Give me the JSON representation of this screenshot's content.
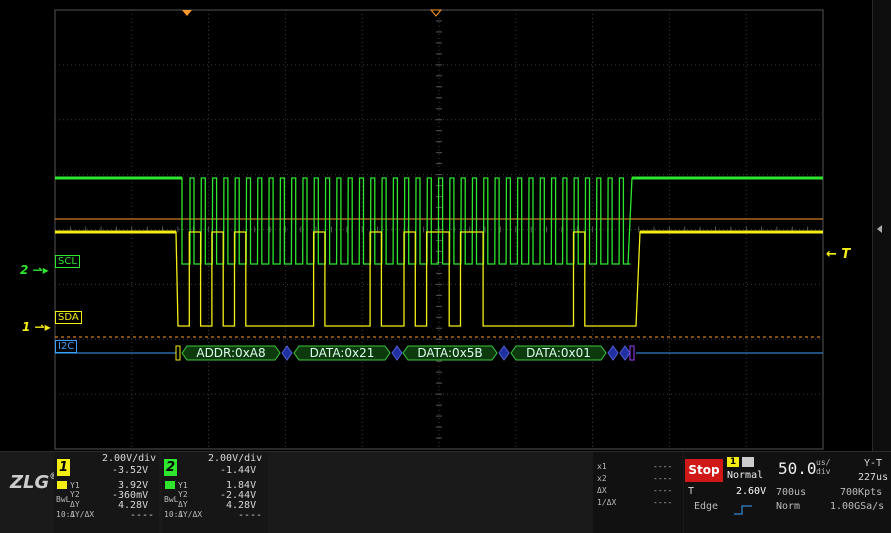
{
  "colors": {
    "ch1": "#f5ee15",
    "ch2": "#2ee62e",
    "decode": "#3aa0ff",
    "trigger": "#ff9a2a",
    "stop": "#d01818"
  },
  "channels": {
    "scl_label": "SCL",
    "sda_label": "SDA",
    "bus_label": "I2C",
    "ch2_marker": "2",
    "ch1_marker": "1",
    "trigger_marker": "T"
  },
  "decode_packets": [
    {
      "label": "ADDR:0xA8"
    },
    {
      "label": "DATA:0x21"
    },
    {
      "label": "DATA:0x5B"
    },
    {
      "label": "DATA:0x01"
    }
  ],
  "ch1_panel": {
    "num": "1",
    "volts_div": "2.00V/div",
    "offset": "-3.52V",
    "y1": "3.92V",
    "y2": "-360mV",
    "dy": "4.28V",
    "dydx": "----",
    "y1_lbl": "Y1",
    "y2_lbl": "Y2",
    "dy_lbl": "ΔY",
    "dydx_lbl": "ΔY/ΔX",
    "bw": "BwL",
    "ratio": "10:1"
  },
  "ch2_panel": {
    "num": "2",
    "volts_div": "2.00V/div",
    "offset": "-1.44V",
    "y1": "1.84V",
    "y2": "-2.44V",
    "dy": "4.28V",
    "dydx": "----",
    "y1_lbl": "Y1",
    "y2_lbl": "Y2",
    "dy_lbl": "ΔY",
    "dydx_lbl": "ΔY/ΔX",
    "bw": "BwL",
    "ratio": "10:1"
  },
  "cursor_panel": {
    "x1_lbl": "x1",
    "x2_lbl": "x2",
    "dx_lbl": "ΔX",
    "inv_lbl": "1/ΔX",
    "x1": "----",
    "x2": "----",
    "dx": "----",
    "inv": "----"
  },
  "trigger_panel": {
    "stop": "Stop",
    "mode": "Normal",
    "source": "1",
    "t_lbl": "T",
    "level": "2.60V",
    "type": "Edge"
  },
  "time_panel": {
    "timebase": "50.0",
    "unit_top": "us/",
    "unit_bot": "div",
    "mode": "Y-T",
    "pos": "227us",
    "window": "700us",
    "pts": "700Kpts",
    "acq": "Norm",
    "rate": "1.00GSa/s"
  },
  "logo": "ZLG"
}
